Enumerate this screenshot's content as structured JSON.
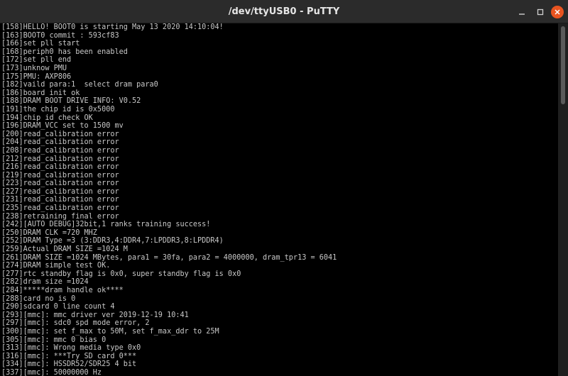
{
  "window": {
    "title": "/dev/ttyUSB0 - PuTTY",
    "controls": {
      "minimize": "–",
      "maximize": "□",
      "close": "×"
    }
  },
  "terminal": {
    "lines": [
      "[158]HELLO! BOOT0 is starting May 13 2020 14:10:04!",
      "[163]BOOT0 commit : 593cf83",
      "[166]set pll start",
      "[168]periph0 has been enabled",
      "[172]set pll end",
      "[173]unknow PMU",
      "[175]PMU: AXP806",
      "[182]vaild para:1  select dram para0",
      "[186]board init ok",
      "[188]DRAM BOOT DRIVE INFO: V0.52",
      "[191]the chip id is 0x5000",
      "[194]chip id check OK",
      "[196]DRAM_VCC set to 1500 mv",
      "[200]read_calibration error",
      "[204]read_calibration error",
      "[208]read_calibration error",
      "[212]read_calibration error",
      "[216]read_calibration error",
      "[219]read_calibration error",
      "[223]read_calibration error",
      "[227]read_calibration error",
      "[231]read_calibration error",
      "[235]read_calibration error",
      "[238]retraining final error",
      "[242][AUTO DEBUG]32bit,1 ranks training success!",
      "[250]DRAM CLK =720 MHZ",
      "[252]DRAM Type =3 (3:DDR3,4:DDR4,7:LPDDR3,8:LPDDR4)",
      "[259]Actual DRAM SIZE =1024 M",
      "[261]DRAM SIZE =1024 MBytes, para1 = 30fa, para2 = 4000000, dram_tpr13 = 6041",
      "[274]DRAM simple test OK.",
      "[277]rtc standby flag is 0x0, super standby flag is 0x0",
      "[282]dram size =1024",
      "[284]*****dram handle ok****",
      "[288]card no is 0",
      "[290]sdcard 0 line count 4",
      "[293][mmc]: mmc driver ver 2019-12-19 10:41",
      "[297][mmc]: sdc0 spd mode error, 2",
      "[300][mmc]: set f_max to 50M, set f_max_ddr to 25M",
      "[305][mmc]: mmc 0 bias 0",
      "[313][mmc]: Wrong media type 0x0",
      "[316][mmc]: ***Try SD card 0***",
      "[334][mmc]: HSSDR52/SDR25 4 bit",
      "[337][mmc]: 50000000 Hz"
    ]
  }
}
